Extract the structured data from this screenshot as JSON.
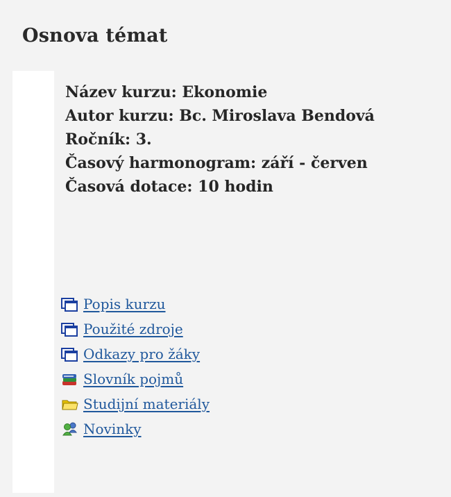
{
  "page": {
    "title": "Osnova témat"
  },
  "course_info": {
    "name": "Název kurzu: Ekonomie",
    "author": "Autor kurzu: Bc. Miroslava Bendová",
    "grade": "Ročník: 3.",
    "schedule": "Časový harmonogram: září - červen",
    "time_allocation": "Časová dotace: 10 hodin"
  },
  "links": [
    {
      "label": "Popis kurzu",
      "icon": "page-icon"
    },
    {
      "label": "Použité zdroje",
      "icon": "page-icon"
    },
    {
      "label": "Odkazy pro žáky",
      "icon": "page-icon"
    },
    {
      "label": "Slovník pojmů",
      "icon": "glossary-books-icon"
    },
    {
      "label": "Studijní materiály",
      "icon": "folder-icon"
    },
    {
      "label": "Novinky",
      "icon": "forum-users-icon"
    }
  ],
  "colors": {
    "link": "#20589c",
    "background": "#f3f3f3"
  }
}
